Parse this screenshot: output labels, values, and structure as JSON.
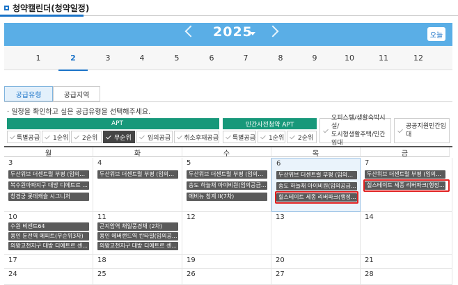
{
  "page": {
    "title": "청약캘린더(청약일정)"
  },
  "banner": {
    "year": "2025",
    "today": "오늘"
  },
  "months": [
    "1",
    "2",
    "3",
    "4",
    "5",
    "6",
    "7",
    "8",
    "9",
    "10",
    "11",
    "12"
  ],
  "tabs": {
    "supply_type": "공급유형",
    "supply_region": "공급지역"
  },
  "note": "· 일정을 확인하고 싶은 공급유형을 선택해주세요.",
  "filters": {
    "apt": {
      "label": "APT",
      "options": [
        "특별공급",
        "1순위",
        "2순위",
        "무순위",
        "임의공급",
        "취소후재공급"
      ]
    },
    "private": {
      "label": "민간사전청약 APT",
      "options": [
        "특별공급",
        "1순위",
        "2순위"
      ]
    },
    "officetel": {
      "line1": "오피스텔/생활숙박시설/",
      "line2": "도시형생활주택/민간임대"
    },
    "public": {
      "label": "공공지원민간임대"
    }
  },
  "weekdays": [
    "월",
    "화",
    "수",
    "목",
    "금"
  ],
  "weeks": [
    {
      "days": [
        {
          "num": "3",
          "events": [
            "두산위브 더센트럴 부평 (임의공...",
            "복수원아파지구 대방 디에트르 ...",
            "창경궁 롯데캐슬 시그니처"
          ]
        },
        {
          "num": "4",
          "events": [
            "두산위브 더센트럴 부평 (임의공..."
          ]
        },
        {
          "num": "5",
          "events": [
            "두산위브 더센트럴 부평 (임의공...",
            "송도 하늘채 아이비원(임의공급...",
            "에비뉴 청계 II(7차)"
          ]
        },
        {
          "num": "6",
          "events": [
            "두산위브 더센트럴 부평 (임의공...",
            "송도 하늘채 아이비원(임의공급...",
            "힐스테이트 세종 리버파크(행정..."
          ]
        },
        {
          "num": "7",
          "events": [
            "두산위브 더센트럴 부평 (임의공...",
            "힐스테이트 세종 리버파크(행정..."
          ]
        }
      ]
    },
    {
      "days": [
        {
          "num": "10",
          "events": [
            "수원 비센트64",
            "용인 둔전역 에피트(무순위3차)",
            "의왕고천지구 대방 디에트르 센..."
          ]
        },
        {
          "num": "11",
          "events": [
            "곤지암역 채일풍경채 (2차)",
            "용인 에버랜드역 칸타빌(임의공...",
            "의왕고천지구 대방 디에트르 센..."
          ]
        },
        {
          "num": "12",
          "events": []
        },
        {
          "num": "13",
          "events": []
        },
        {
          "num": "14",
          "events": []
        }
      ]
    },
    {
      "days": [
        {
          "num": "17",
          "events": []
        },
        {
          "num": "18",
          "events": []
        },
        {
          "num": "19",
          "events": []
        },
        {
          "num": "20",
          "events": []
        },
        {
          "num": "21",
          "events": []
        }
      ]
    },
    {
      "days": [
        {
          "num": "24",
          "events": []
        },
        {
          "num": "25",
          "events": []
        },
        {
          "num": "26",
          "events": []
        },
        {
          "num": "27",
          "events": []
        },
        {
          "num": "28",
          "events": []
        }
      ]
    }
  ]
}
